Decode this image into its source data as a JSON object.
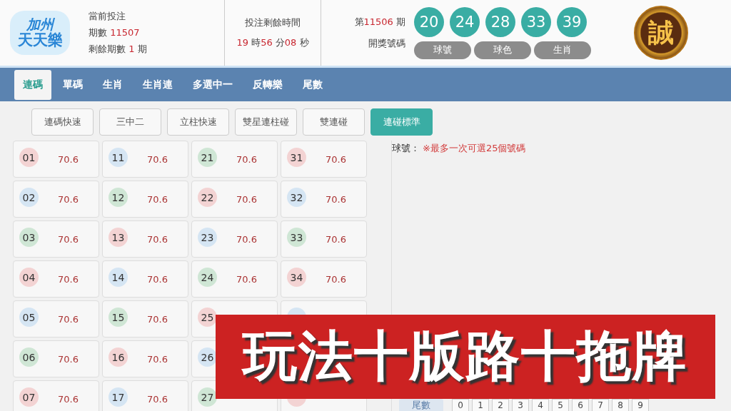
{
  "logo": {
    "line_1": "加州",
    "line_2": "天天樂"
  },
  "current": {
    "label": "當前投注",
    "period_label": "期數",
    "period": "11507",
    "remaining_label": "剩餘期數",
    "remaining": "1",
    "remaining_unit": "期"
  },
  "countdown": {
    "title": "投注剩餘時間",
    "parts": [
      {
        "value": "19",
        "unit": "時"
      },
      {
        "value": "56",
        "unit": "分"
      },
      {
        "value": "08",
        "unit": "秒"
      }
    ]
  },
  "last_draw": {
    "prefix": "第",
    "period": "11506",
    "suffix": "期",
    "label": "開獎號碼",
    "balls": [
      "20",
      "24",
      "28",
      "33",
      "39"
    ],
    "views": [
      {
        "label": "球號"
      },
      {
        "label": "球色"
      },
      {
        "label": "生肖"
      }
    ]
  },
  "badge": "誠",
  "tabs": [
    {
      "label": "連碼",
      "selected": true
    },
    {
      "label": "單碼",
      "selected": false
    },
    {
      "label": "生肖",
      "selected": false
    },
    {
      "label": "生肖連",
      "selected": false
    },
    {
      "label": "多選中一",
      "selected": false
    },
    {
      "label": "反轉樂",
      "selected": false
    },
    {
      "label": "尾數",
      "selected": false
    }
  ],
  "subtabs": [
    {
      "label": "連碼快速",
      "selected": false
    },
    {
      "label": "三中二",
      "selected": false
    },
    {
      "label": "立柱快速",
      "selected": false
    },
    {
      "label": "雙星連柱碰",
      "selected": false
    },
    {
      "label": "雙連碰",
      "selected": false
    },
    {
      "label": "連碰標準",
      "selected": true
    }
  ],
  "number_rows": [
    [
      {
        "number": "01",
        "color": "#f3d3d3",
        "odds": "70.6"
      },
      {
        "number": "11",
        "color": "#d5e5f3",
        "odds": "70.6"
      },
      {
        "number": "21",
        "color": "#cfe6d5",
        "odds": "70.6"
      },
      {
        "number": "31",
        "color": "#f3d3d3",
        "odds": "70.6"
      }
    ],
    [
      {
        "number": "02",
        "color": "#d5e5f3",
        "odds": "70.6"
      },
      {
        "number": "12",
        "color": "#cfe6d5",
        "odds": "70.6"
      },
      {
        "number": "22",
        "color": "#f3d3d3",
        "odds": "70.6"
      },
      {
        "number": "32",
        "color": "#d5e5f3",
        "odds": "70.6"
      }
    ],
    [
      {
        "number": "03",
        "color": "#cfe6d5",
        "odds": "70.6"
      },
      {
        "number": "13",
        "color": "#f3d3d3",
        "odds": "70.6"
      },
      {
        "number": "23",
        "color": "#d5e5f3",
        "odds": "70.6"
      },
      {
        "number": "33",
        "color": "#cfe6d5",
        "odds": "70.6"
      }
    ],
    [
      {
        "number": "04",
        "color": "#f3d3d3",
        "odds": "70.6"
      },
      {
        "number": "14",
        "color": "#d5e5f3",
        "odds": "70.6"
      },
      {
        "number": "24",
        "color": "#cfe6d5",
        "odds": "70.6"
      },
      {
        "number": "34",
        "color": "#f3d3d3",
        "odds": "70.6"
      }
    ],
    [
      {
        "number": "05",
        "color": "#d5e5f3",
        "odds": "70.6"
      },
      {
        "number": "15",
        "color": "#cfe6d5",
        "odds": "70.6"
      },
      {
        "number": "25",
        "color": "#f3d3d3"
      },
      {
        "color": "#d5e5f3"
      }
    ],
    [
      {
        "number": "06",
        "color": "#cfe6d5",
        "odds": "70.6"
      },
      {
        "number": "16",
        "color": "#f3d3d3",
        "odds": "70.6"
      },
      {
        "number": "26",
        "color": "#d5e5f3"
      }
    ],
    [
      {
        "number": "07",
        "color": "#f3d3d3",
        "odds": "70.6"
      },
      {
        "number": "17",
        "color": "#d5e5f3",
        "odds": "70.6"
      },
      {
        "number": "27",
        "color": "#cfe6d5"
      },
      {
        "color": "#f3d3d3"
      }
    ]
  ],
  "panel": {
    "label": "球號：",
    "note": "※最多一次可選25個號碼",
    "tail_label": "尾數",
    "digits": [
      "0",
      "1",
      "2",
      "3",
      "4",
      "5",
      "6",
      "7",
      "8",
      "9"
    ]
  },
  "banner": "玩法十版路十拖牌"
}
